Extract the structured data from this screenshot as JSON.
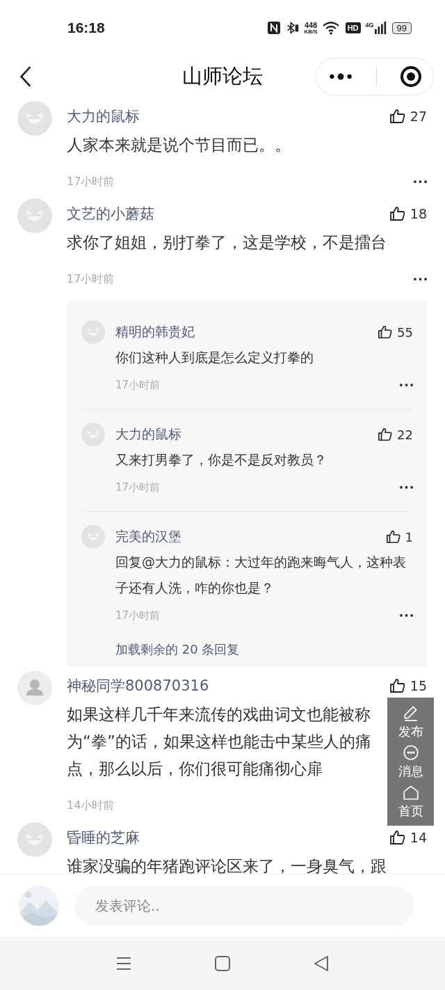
{
  "status_bar": {
    "time": "16:18",
    "speed_value": "448",
    "speed_unit": "KB/S",
    "hd": "HD",
    "network": "4G",
    "battery": "99"
  },
  "nav": {
    "title": "山师论坛"
  },
  "comments": [
    {
      "avatar": {
        "kind": "emoji"
      },
      "name": "大力的鼠标",
      "likes": "27",
      "text": "人家本来就是说个节目而已。。",
      "time": "17小时前",
      "more_shown": true
    },
    {
      "avatar": {
        "kind": "emoji"
      },
      "name": "文艺的小蘑菇",
      "likes": "18",
      "text": "求你了姐姐，别打拳了，这是学校，不是擂台",
      "time": "17小时前",
      "more_shown": true,
      "replies": [
        {
          "avatar": {
            "kind": "emoji"
          },
          "name": "精明的韩贵妃",
          "likes": "55",
          "text": "你们这种人到底是怎么定义打拳的",
          "time": "17小时前"
        },
        {
          "avatar": {
            "kind": "emoji"
          },
          "name": "大力的鼠标",
          "likes": "22",
          "text": "又来打男拳了，你是不是反对教员？",
          "time": "17小时前"
        },
        {
          "avatar": {
            "kind": "emoji"
          },
          "name": "完美的汉堡",
          "likes": "1",
          "text": "回复@大力的鼠标：大过年的跑来晦气人，这种表子还有人洗，咋的你也是？",
          "time": "17小时前"
        }
      ],
      "load_more": "加载剩余的 20 条回复"
    },
    {
      "avatar": {
        "kind": "silhouette"
      },
      "name": "神秘同学800870316",
      "likes": "15",
      "text": "如果这样几千年来流传的戏曲词文也能被称为“拳”的话，如果这样也能击中某些人的痛点，那么以后，你们很可能痛彻心扉",
      "time": "14小时前",
      "more_shown": false
    },
    {
      "avatar": {
        "kind": "emoji"
      },
      "name": "昏睡的芝麻",
      "likes": "14",
      "text": "谁家没骗的年猪跑评论区来了，一身臭气，跟"
    }
  ],
  "float_menu": [
    {
      "kind": "post",
      "label": "发布"
    },
    {
      "kind": "message",
      "label": "消息"
    },
    {
      "kind": "home",
      "label": "首页"
    }
  ],
  "composer": {
    "placeholder": "发表评论.."
  }
}
